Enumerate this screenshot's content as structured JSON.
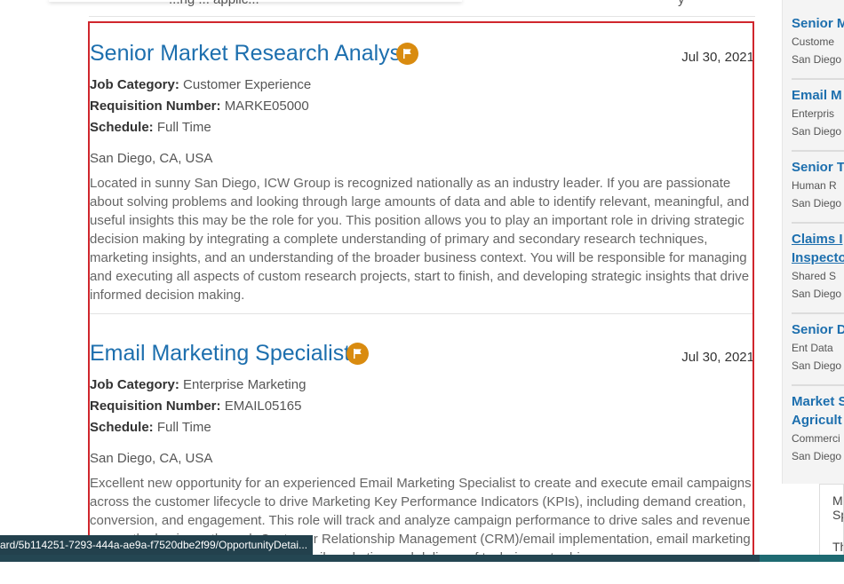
{
  "top": {
    "partial_text": "...ng ... applic...",
    "partial_right": "y"
  },
  "jobs": [
    {
      "title": "Senior Market Research Analyst",
      "date": "Jul 30, 2021",
      "category_label": "Job Category:",
      "category": "Customer Experience",
      "req_label": "Requisition Number:",
      "req": "MARKE05000",
      "schedule_label": "Schedule:",
      "schedule": "Full Time",
      "location": "San Diego, CA, USA",
      "description": "Located in sunny San Diego, ICW Group is recognized nationally as an industry leader. If you are passionate about solving problems and looking through large amounts of data and able to identify relevant, meaningful, and useful insights this may be the role for you. This position allows you to play an important role in driving strategic decision making by integrating a complete understanding of primary and secondary research techniques, marketing insights, and an understanding of the broader business context. You will be responsible for managing and executing all aspects of custom research projects, start to finish, and developing strategic insights that drive informed decision making."
    },
    {
      "title": "Email Marketing Specialist",
      "date": "Jul 30, 2021",
      "category_label": "Job Category:",
      "category": "Enterprise Marketing",
      "req_label": "Requisition Number:",
      "req": "EMAIL05165",
      "schedule_label": "Schedule:",
      "schedule": "Full Time",
      "location": "San Diego, CA, USA",
      "description": "Excellent new opportunity for an experienced Email Marketing Specialist to create and execute email campaigns across the customer lifecycle to drive Marketing Key Performance Indicators (KPIs), including demand creation, conversion, and engagement. This role will track and analyze campaign performance to drive sales and revenue across the business through Customer Relationship Management (CRM)/email implementation, email marketing strategy, ...corporate best practice email marketing and delivery of techniques to drive..."
    }
  ],
  "sidebar": {
    "items": [
      {
        "title": "Senior M",
        "sub1": "Custome",
        "sub2": "San Diego"
      },
      {
        "title": "Email M",
        "sub1": "Enterpris",
        "sub2": "San Diego"
      },
      {
        "title": "Senior T",
        "sub1": "Human R",
        "sub2": "San Diego"
      },
      {
        "title": "Claims I",
        "title2": "Inspecto",
        "sub1": "Shared S",
        "sub2": "San Diego"
      },
      {
        "title": "Senior D",
        "sub1": "Ent Data",
        "sub2": "San Diego"
      },
      {
        "title": "Market S",
        "title2": "Agricult",
        "sub1": "Commerci",
        "sub2": "San Diego"
      }
    ]
  },
  "side_panel": {
    "line1": "M",
    "line2": "Sp",
    "line3": "Th"
  },
  "status_url": "ard/5b114251-7293-444a-ae9a-f7520dbe2f99/OpportunityDetai..."
}
